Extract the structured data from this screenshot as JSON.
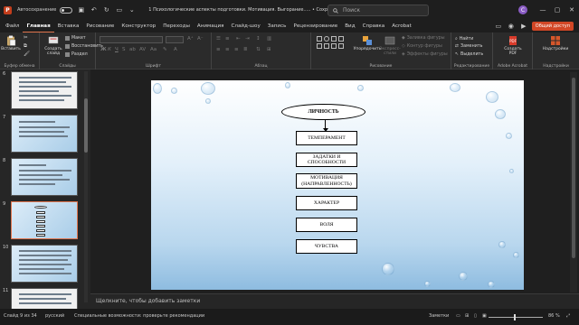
{
  "titlebar": {
    "autosave_label": "Автосохранение",
    "doc_title": "1 Психологические аспекты подготовки. Мотивация. Выгорание.....  •  Сохранено в: этот компьютер ⌄",
    "search_placeholder": "Поиск",
    "user_initial": "C"
  },
  "menu": {
    "tabs": [
      "Файл",
      "Главная",
      "Вставка",
      "Рисование",
      "Конструктор",
      "Переходы",
      "Анимация",
      "Слайд-шоу",
      "Запись",
      "Рецензирование",
      "Вид",
      "Справка",
      "Acrobat"
    ],
    "active": "Главная",
    "share_label": "Общий доступ"
  },
  "ribbon": {
    "paste": "Вставить",
    "clipboard_group": "Буфер обмена",
    "new_slide": "Создать слайд",
    "layout": "Макет",
    "reset": "Восстановить",
    "section": "Раздел",
    "slides_group": "Слайды",
    "font_group": "Шрифт",
    "paragraph_group": "Абзац",
    "drawing_group": "Рисование",
    "arrange": "Упорядочить",
    "quick_styles": "Экспресс-стили",
    "shape_fill": "Заливка фигуры",
    "shape_outline": "Контур фигуры",
    "shape_effects": "Эффекты фигуры",
    "find": "Найти",
    "replace": "Заменить",
    "select": "Выделить",
    "editing_group": "Редактирование",
    "create_pdf": "Создать PDF",
    "acrobat_group": "Adobe Acrobat",
    "addins": "Надстройки",
    "addins_group": "Надстройки"
  },
  "thumbnails": {
    "numbers": [
      "6",
      "7",
      "8",
      "9",
      "10",
      "11"
    ],
    "active_index": 3
  },
  "slide": {
    "root": "ЛИЧНОСТЬ",
    "boxes": [
      "ТЕМПЕРАМЕНТ",
      "ЗАДАТКИ И СПОСОБНОСТИ",
      "МОТИВАЦИЯ (НАПРАВЛЕННОСТЬ)",
      "ХАРАКТЕР",
      "ВОЛЯ",
      "ЧУВСТВА"
    ]
  },
  "notes": {
    "placeholder": "Щелкните, чтобы добавить заметки"
  },
  "status": {
    "slide_info": "Слайд 9 из 34",
    "language": "русский",
    "accessibility": "Специальные возможности: проверьте рекомендации",
    "notes_btn": "Заметки",
    "zoom": "86 %"
  },
  "colors": {
    "accent": "#d24726",
    "active_tab_underline": "#e0744d"
  }
}
